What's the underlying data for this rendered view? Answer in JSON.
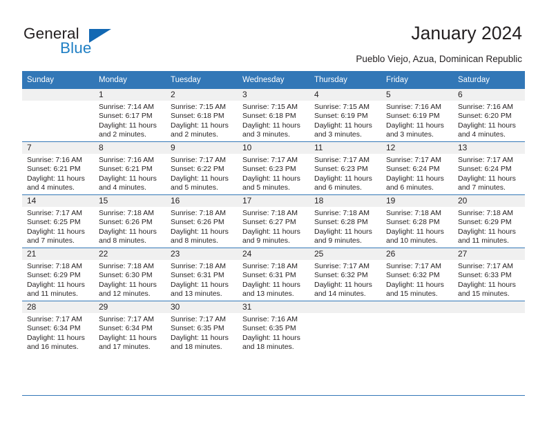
{
  "brand": {
    "name_part1": "General",
    "name_part2": "Blue",
    "logo_icon": "blue-triangle-logo"
  },
  "header": {
    "title": "January 2024",
    "subtitle": "Pueblo Viejo, Azua, Dominican Republic"
  },
  "colors": {
    "header_band": "#3277b7",
    "brand_blue": "#1f7fc4",
    "daynum_band": "#f0f0f0",
    "text": "#231f20"
  },
  "weekday_headers": [
    "Sunday",
    "Monday",
    "Tuesday",
    "Wednesday",
    "Thursday",
    "Friday",
    "Saturday"
  ],
  "weeks": [
    [
      {
        "day": "",
        "empty": true,
        "sunrise": "",
        "sunset": "",
        "daylight_line1": "",
        "daylight_line2": ""
      },
      {
        "day": "1",
        "sunrise": "Sunrise: 7:14 AM",
        "sunset": "Sunset: 6:17 PM",
        "daylight_line1": "Daylight: 11 hours",
        "daylight_line2": "and 2 minutes."
      },
      {
        "day": "2",
        "sunrise": "Sunrise: 7:15 AM",
        "sunset": "Sunset: 6:18 PM",
        "daylight_line1": "Daylight: 11 hours",
        "daylight_line2": "and 2 minutes."
      },
      {
        "day": "3",
        "sunrise": "Sunrise: 7:15 AM",
        "sunset": "Sunset: 6:18 PM",
        "daylight_line1": "Daylight: 11 hours",
        "daylight_line2": "and 3 minutes."
      },
      {
        "day": "4",
        "sunrise": "Sunrise: 7:15 AM",
        "sunset": "Sunset: 6:19 PM",
        "daylight_line1": "Daylight: 11 hours",
        "daylight_line2": "and 3 minutes."
      },
      {
        "day": "5",
        "sunrise": "Sunrise: 7:16 AM",
        "sunset": "Sunset: 6:19 PM",
        "daylight_line1": "Daylight: 11 hours",
        "daylight_line2": "and 3 minutes."
      },
      {
        "day": "6",
        "sunrise": "Sunrise: 7:16 AM",
        "sunset": "Sunset: 6:20 PM",
        "daylight_line1": "Daylight: 11 hours",
        "daylight_line2": "and 4 minutes."
      }
    ],
    [
      {
        "day": "7",
        "sunrise": "Sunrise: 7:16 AM",
        "sunset": "Sunset: 6:21 PM",
        "daylight_line1": "Daylight: 11 hours",
        "daylight_line2": "and 4 minutes."
      },
      {
        "day": "8",
        "sunrise": "Sunrise: 7:16 AM",
        "sunset": "Sunset: 6:21 PM",
        "daylight_line1": "Daylight: 11 hours",
        "daylight_line2": "and 4 minutes."
      },
      {
        "day": "9",
        "sunrise": "Sunrise: 7:17 AM",
        "sunset": "Sunset: 6:22 PM",
        "daylight_line1": "Daylight: 11 hours",
        "daylight_line2": "and 5 minutes."
      },
      {
        "day": "10",
        "sunrise": "Sunrise: 7:17 AM",
        "sunset": "Sunset: 6:23 PM",
        "daylight_line1": "Daylight: 11 hours",
        "daylight_line2": "and 5 minutes."
      },
      {
        "day": "11",
        "sunrise": "Sunrise: 7:17 AM",
        "sunset": "Sunset: 6:23 PM",
        "daylight_line1": "Daylight: 11 hours",
        "daylight_line2": "and 6 minutes."
      },
      {
        "day": "12",
        "sunrise": "Sunrise: 7:17 AM",
        "sunset": "Sunset: 6:24 PM",
        "daylight_line1": "Daylight: 11 hours",
        "daylight_line2": "and 6 minutes."
      },
      {
        "day": "13",
        "sunrise": "Sunrise: 7:17 AM",
        "sunset": "Sunset: 6:24 PM",
        "daylight_line1": "Daylight: 11 hours",
        "daylight_line2": "and 7 minutes."
      }
    ],
    [
      {
        "day": "14",
        "sunrise": "Sunrise: 7:17 AM",
        "sunset": "Sunset: 6:25 PM",
        "daylight_line1": "Daylight: 11 hours",
        "daylight_line2": "and 7 minutes."
      },
      {
        "day": "15",
        "sunrise": "Sunrise: 7:18 AM",
        "sunset": "Sunset: 6:26 PM",
        "daylight_line1": "Daylight: 11 hours",
        "daylight_line2": "and 8 minutes."
      },
      {
        "day": "16",
        "sunrise": "Sunrise: 7:18 AM",
        "sunset": "Sunset: 6:26 PM",
        "daylight_line1": "Daylight: 11 hours",
        "daylight_line2": "and 8 minutes."
      },
      {
        "day": "17",
        "sunrise": "Sunrise: 7:18 AM",
        "sunset": "Sunset: 6:27 PM",
        "daylight_line1": "Daylight: 11 hours",
        "daylight_line2": "and 9 minutes."
      },
      {
        "day": "18",
        "sunrise": "Sunrise: 7:18 AM",
        "sunset": "Sunset: 6:28 PM",
        "daylight_line1": "Daylight: 11 hours",
        "daylight_line2": "and 9 minutes."
      },
      {
        "day": "19",
        "sunrise": "Sunrise: 7:18 AM",
        "sunset": "Sunset: 6:28 PM",
        "daylight_line1": "Daylight: 11 hours",
        "daylight_line2": "and 10 minutes."
      },
      {
        "day": "20",
        "sunrise": "Sunrise: 7:18 AM",
        "sunset": "Sunset: 6:29 PM",
        "daylight_line1": "Daylight: 11 hours",
        "daylight_line2": "and 11 minutes."
      }
    ],
    [
      {
        "day": "21",
        "sunrise": "Sunrise: 7:18 AM",
        "sunset": "Sunset: 6:29 PM",
        "daylight_line1": "Daylight: 11 hours",
        "daylight_line2": "and 11 minutes."
      },
      {
        "day": "22",
        "sunrise": "Sunrise: 7:18 AM",
        "sunset": "Sunset: 6:30 PM",
        "daylight_line1": "Daylight: 11 hours",
        "daylight_line2": "and 12 minutes."
      },
      {
        "day": "23",
        "sunrise": "Sunrise: 7:18 AM",
        "sunset": "Sunset: 6:31 PM",
        "daylight_line1": "Daylight: 11 hours",
        "daylight_line2": "and 13 minutes."
      },
      {
        "day": "24",
        "sunrise": "Sunrise: 7:18 AM",
        "sunset": "Sunset: 6:31 PM",
        "daylight_line1": "Daylight: 11 hours",
        "daylight_line2": "and 13 minutes."
      },
      {
        "day": "25",
        "sunrise": "Sunrise: 7:17 AM",
        "sunset": "Sunset: 6:32 PM",
        "daylight_line1": "Daylight: 11 hours",
        "daylight_line2": "and 14 minutes."
      },
      {
        "day": "26",
        "sunrise": "Sunrise: 7:17 AM",
        "sunset": "Sunset: 6:32 PM",
        "daylight_line1": "Daylight: 11 hours",
        "daylight_line2": "and 15 minutes."
      },
      {
        "day": "27",
        "sunrise": "Sunrise: 7:17 AM",
        "sunset": "Sunset: 6:33 PM",
        "daylight_line1": "Daylight: 11 hours",
        "daylight_line2": "and 15 minutes."
      }
    ],
    [
      {
        "day": "28",
        "sunrise": "Sunrise: 7:17 AM",
        "sunset": "Sunset: 6:34 PM",
        "daylight_line1": "Daylight: 11 hours",
        "daylight_line2": "and 16 minutes."
      },
      {
        "day": "29",
        "sunrise": "Sunrise: 7:17 AM",
        "sunset": "Sunset: 6:34 PM",
        "daylight_line1": "Daylight: 11 hours",
        "daylight_line2": "and 17 minutes."
      },
      {
        "day": "30",
        "sunrise": "Sunrise: 7:17 AM",
        "sunset": "Sunset: 6:35 PM",
        "daylight_line1": "Daylight: 11 hours",
        "daylight_line2": "and 18 minutes."
      },
      {
        "day": "31",
        "sunrise": "Sunrise: 7:16 AM",
        "sunset": "Sunset: 6:35 PM",
        "daylight_line1": "Daylight: 11 hours",
        "daylight_line2": "and 18 minutes."
      },
      {
        "day": "",
        "empty": true,
        "sunrise": "",
        "sunset": "",
        "daylight_line1": "",
        "daylight_line2": ""
      },
      {
        "day": "",
        "empty": true,
        "sunrise": "",
        "sunset": "",
        "daylight_line1": "",
        "daylight_line2": ""
      },
      {
        "day": "",
        "empty": true,
        "sunrise": "",
        "sunset": "",
        "daylight_line1": "",
        "daylight_line2": ""
      }
    ]
  ]
}
